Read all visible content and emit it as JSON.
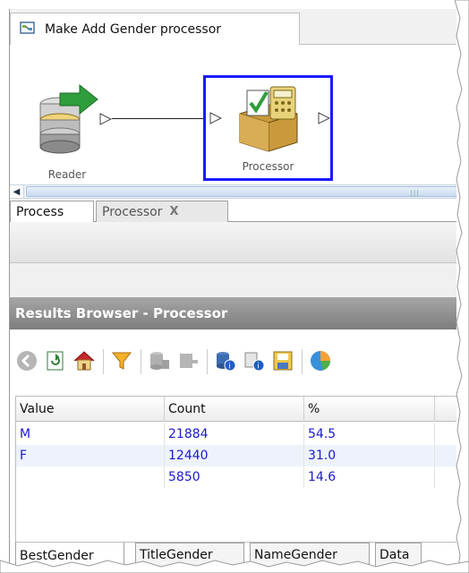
{
  "document_tab": {
    "label": "Make Add Gender processor",
    "icon": "process-diagram-icon"
  },
  "canvas": {
    "nodes": [
      {
        "label": "Reader",
        "icon": "database-reader-icon"
      },
      {
        "label": "Processor",
        "icon": "processor-box-icon"
      }
    ]
  },
  "process_tabs": [
    {
      "label": "Process"
    },
    {
      "label": "Processor",
      "close": "X"
    }
  ],
  "results": {
    "title": "Results Browser - Processor",
    "toolbar_icons": [
      "back-icon",
      "refresh-icon",
      "home-icon",
      "filter-icon",
      "export-icon",
      "pin-icon",
      "database-info-icon",
      "record-info-icon",
      "save-icon",
      "pie-chart-icon"
    ],
    "columns": [
      "Value",
      "Count",
      "%"
    ],
    "rows": [
      {
        "value": "M",
        "count": "21884",
        "pct": "54.5"
      },
      {
        "value": "F",
        "count": "12440",
        "pct": "31.0"
      },
      {
        "value": "",
        "count": "5850",
        "pct": "14.6"
      }
    ],
    "bottom_tabs": [
      "BestGender",
      "TitleGender",
      "NameGender",
      "Data"
    ]
  },
  "colors": {
    "selection_border": "#1a1aff",
    "value_text": "#1a1acc",
    "title_bar": "#8c8c8c"
  }
}
